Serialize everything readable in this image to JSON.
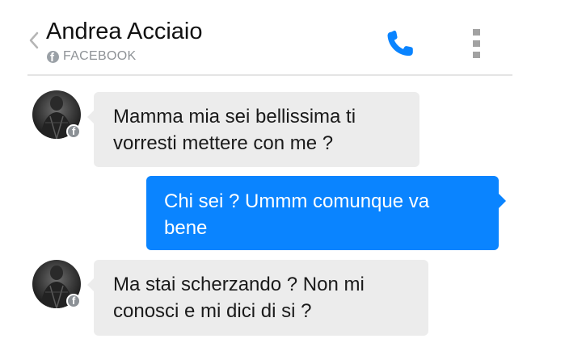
{
  "header": {
    "contact_name": "Andrea Acciaio",
    "source_label": "FACEBOOK",
    "source_icon": "facebook-icon",
    "call_icon": "phone-icon",
    "more_icon": "more-vertical-icon",
    "accent_color": "#0a84ff"
  },
  "messages": [
    {
      "direction": "incoming",
      "text": "Mamma mia sei bellissima ti\nvorresti mettere con me ?"
    },
    {
      "direction": "outgoing",
      "text": "Chi sei ? Ummm comunque va\nbene"
    },
    {
      "direction": "incoming",
      "text": "Ma stai scherzando ? Non mi\nconosci e mi dici di si ?"
    }
  ],
  "colors": {
    "incoming_bubble": "#ececec",
    "outgoing_bubble": "#0a84ff",
    "secondary_text": "#8e9296"
  }
}
